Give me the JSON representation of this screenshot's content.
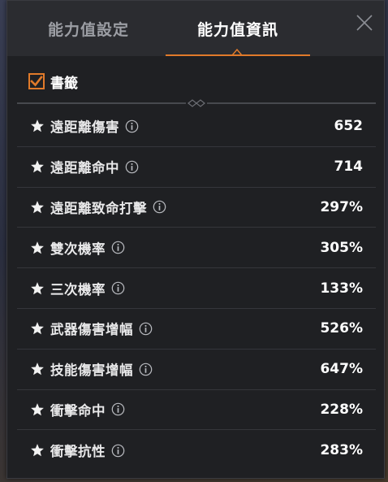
{
  "tabs": [
    {
      "label": "能力值設定",
      "active": false
    },
    {
      "label": "能力值資訊",
      "active": true
    }
  ],
  "bookmark": {
    "label": "書籤",
    "checked": true
  },
  "stats": [
    {
      "name": "遠距離傷害",
      "value": "652"
    },
    {
      "name": "遠距離命中",
      "value": "714"
    },
    {
      "name": "遠距離致命打擊",
      "value": "297%"
    },
    {
      "name": "雙次機率",
      "value": "305%"
    },
    {
      "name": "三次機率",
      "value": "133%"
    },
    {
      "name": "武器傷害增幅",
      "value": "526%"
    },
    {
      "name": "技能傷害增幅",
      "value": "647%"
    },
    {
      "name": "衝擊命中",
      "value": "228%"
    },
    {
      "name": "衝擊抗性",
      "value": "283%"
    }
  ],
  "icons": {
    "close": "close-icon",
    "checkbox": "checkbox-checked-icon",
    "star": "star-icon",
    "info": "info-icon"
  },
  "colors": {
    "accent": "#e07a2a",
    "panel_bg": "#1f2023",
    "tab_bar_bg": "#2b2c30",
    "text_primary": "#ffffff",
    "text_inactive": "#9c9ea4"
  }
}
